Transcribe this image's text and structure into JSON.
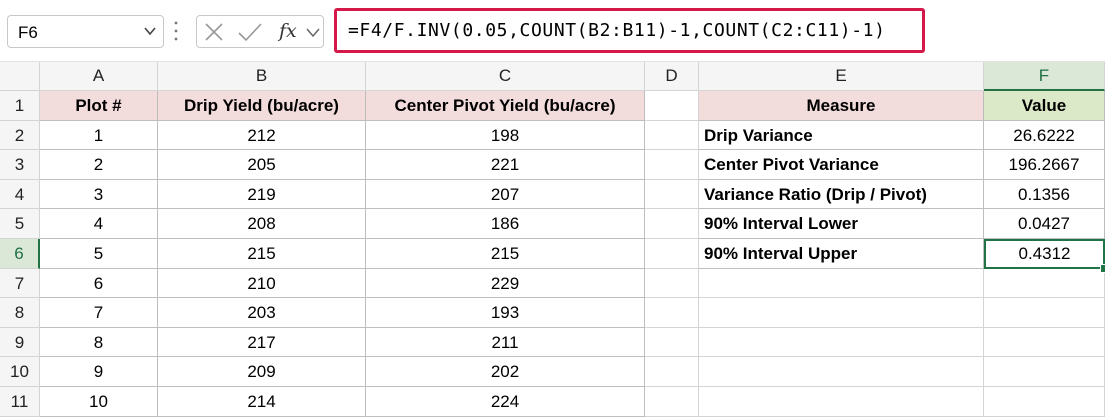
{
  "name_box": {
    "value": "F6"
  },
  "formula_bar": {
    "fx_label": "fx",
    "formula": "=F4/F.INV(0.05,COUNT(B2:B11)-1,COUNT(C2:C11)-1)"
  },
  "columns": [
    "A",
    "B",
    "C",
    "D",
    "E",
    "F"
  ],
  "rows": [
    "1",
    "2",
    "3",
    "4",
    "5",
    "6",
    "7",
    "8",
    "9",
    "10",
    "11"
  ],
  "selected": {
    "column": "F",
    "row": "6"
  },
  "table1": {
    "headers": [
      "Plot #",
      "Drip Yield (bu/acre)",
      "Center Pivot Yield (bu/acre)"
    ],
    "rows": [
      [
        "1",
        "212",
        "198"
      ],
      [
        "2",
        "205",
        "221"
      ],
      [
        "3",
        "219",
        "207"
      ],
      [
        "4",
        "208",
        "186"
      ],
      [
        "5",
        "215",
        "215"
      ],
      [
        "6",
        "210",
        "229"
      ],
      [
        "7",
        "203",
        "193"
      ],
      [
        "8",
        "217",
        "211"
      ],
      [
        "9",
        "209",
        "202"
      ],
      [
        "10",
        "214",
        "224"
      ]
    ]
  },
  "table2": {
    "headers": [
      "Measure",
      "Value"
    ],
    "rows": [
      [
        "Drip Variance",
        "26.6222"
      ],
      [
        "Center Pivot Variance",
        "196.2667"
      ],
      [
        "Variance Ratio (Drip / Pivot)",
        "0.1356"
      ],
      [
        "90% Interval Lower",
        "0.0427"
      ],
      [
        "90% Interval Upper",
        "0.4312"
      ]
    ]
  },
  "colors": {
    "header_pink": "#f3dcdc",
    "header_green": "#dce9c9",
    "formula_highlight": "#d5184a",
    "selection_green": "#217346"
  }
}
